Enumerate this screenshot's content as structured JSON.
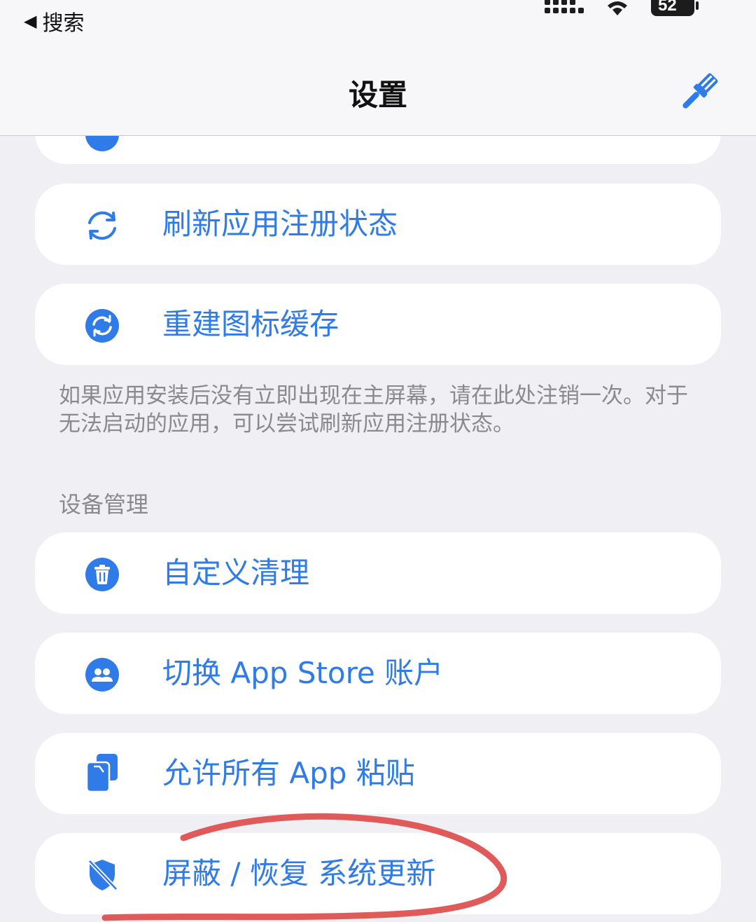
{
  "status_bar": {
    "back_label": "搜索",
    "battery": "52"
  },
  "header": {
    "title": "设置",
    "right_icon": "brush-icon"
  },
  "items_top": [
    {
      "label": "刷新应用注册状态",
      "icon": "refresh-arrows-icon"
    },
    {
      "label": "重建图标缓存",
      "icon": "rebuild-cache-icon"
    }
  ],
  "note": "如果应用安装后没有立即出现在主屏幕，请在此处注销一次。对于无法启动的应用，可以尝试刷新应用注册状态。",
  "section_title": "设备管理",
  "device_items": [
    {
      "label": "自定义清理",
      "icon": "trash-icon"
    },
    {
      "label": "切换 App Store 账户",
      "icon": "accounts-icon"
    },
    {
      "label": "允许所有 App 粘贴",
      "icon": "clipboard-icon"
    },
    {
      "label": "屏蔽 / 恢复 系统更新",
      "icon": "shield-off-icon"
    }
  ],
  "colors": {
    "accent": "#2f7be8",
    "background": "#efeff4",
    "card": "#ffffff",
    "annotation": "#e05a5a"
  }
}
